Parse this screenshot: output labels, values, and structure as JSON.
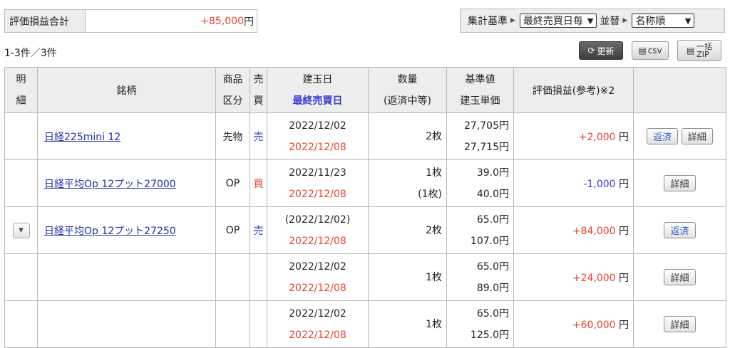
{
  "summary": {
    "label": "評価損益合計",
    "value": "+85,000",
    "unit": "円"
  },
  "aggregate": {
    "basis_label": "集計基準",
    "basis_value": "最終売買日毎",
    "sort_label": "並替",
    "sort_value": "名称順"
  },
  "count_text": "1-3件／3件",
  "toolbar": {
    "refresh": "更新",
    "csv": "csv",
    "zip_top": "一括",
    "zip_bottom": "ZIP"
  },
  "headers": {
    "detail": [
      "明",
      "細"
    ],
    "name": "銘柄",
    "product": [
      "商品",
      "区分"
    ],
    "trade": [
      "売",
      "買"
    ],
    "date": [
      "建玉日",
      "最終売買日"
    ],
    "qty": [
      "数量",
      "(返済中等)"
    ],
    "price": [
      "基準値",
      "建玉単価"
    ],
    "pl": "評価損益(参考)※2"
  },
  "rows": [
    {
      "name": "日経225mini 12",
      "product": "先物",
      "trade": "売",
      "trade_color": "blue",
      "date": "2022/12/02",
      "last_date": "2022/12/08",
      "qty": "2枚",
      "qty_sub": "",
      "price": "27,705円",
      "unit_price": "27,715円",
      "pl": "+2,000",
      "pl_color": "red",
      "pl_unit": "円",
      "btn_repay": "返済",
      "btn_detail": "詳細",
      "expand": false
    },
    {
      "name": "日経平均Op 12プット27000",
      "product": "OP",
      "trade": "買",
      "trade_color": "red",
      "date": "2022/11/23",
      "last_date": "2022/12/08",
      "qty": "1枚",
      "qty_sub": "(1枚)",
      "price": "39.0円",
      "unit_price": "40.0円",
      "pl": "-1,000",
      "pl_color": "blue",
      "pl_unit": "円",
      "btn_repay": "",
      "btn_detail": "詳細",
      "expand": false
    },
    {
      "name": "日経平均Op 12プット27250",
      "product": "OP",
      "trade": "売",
      "trade_color": "blue",
      "date": "(2022/12/02)",
      "last_date": "2022/12/08",
      "qty": "2枚",
      "qty_sub": "",
      "price": "65.0円",
      "unit_price": "107.0円",
      "pl": "+84,000",
      "pl_color": "red",
      "pl_unit": "円",
      "btn_repay": "返済",
      "btn_detail": "",
      "expand": true
    },
    {
      "name": "",
      "product": "",
      "trade": "",
      "trade_color": "",
      "date": "2022/12/02",
      "last_date": "2022/12/08",
      "qty": "1枚",
      "qty_sub": "",
      "price": "65.0円",
      "unit_price": "89.0円",
      "pl": "+24,000",
      "pl_color": "red",
      "pl_unit": "円",
      "btn_repay": "",
      "btn_detail": "詳細",
      "expand": false
    },
    {
      "name": "",
      "product": "",
      "trade": "",
      "trade_color": "",
      "date": "2022/12/02",
      "last_date": "2022/12/08",
      "qty": "1枚",
      "qty_sub": "",
      "price": "65.0円",
      "unit_price": "125.0円",
      "pl": "+60,000",
      "pl_color": "red",
      "pl_unit": "円",
      "btn_repay": "",
      "btn_detail": "詳細",
      "expand": false
    }
  ]
}
